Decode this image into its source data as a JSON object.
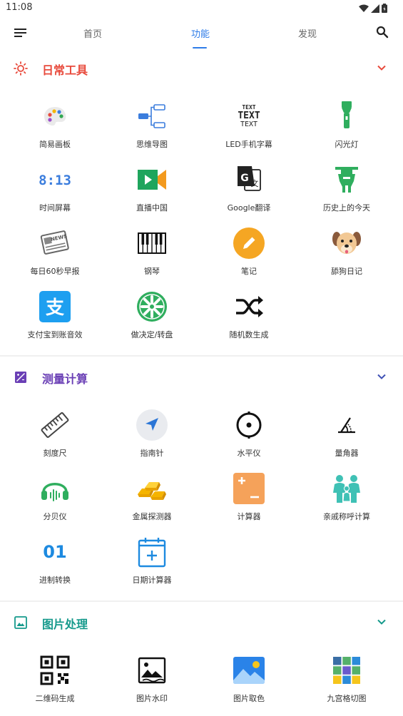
{
  "status": {
    "time": "11:08"
  },
  "tabs": [
    {
      "label": "首页"
    },
    {
      "label": "功能"
    },
    {
      "label": "发现"
    }
  ],
  "sections": [
    {
      "title": "日常工具",
      "color": "#e84a3c",
      "items": [
        {
          "label": "简易画板",
          "icon": "palette-icon"
        },
        {
          "label": "思维导图",
          "icon": "mindmap-icon"
        },
        {
          "label": "LED手机字幕",
          "icon": "led-text-icon"
        },
        {
          "label": "闪光灯",
          "icon": "flashlight-icon"
        },
        {
          "label": "时间屏幕",
          "icon": "clock-digits-icon",
          "icon_text": "8:13"
        },
        {
          "label": "直播中国",
          "icon": "video-camera-icon"
        },
        {
          "label": "Google翻译",
          "icon": "translate-icon"
        },
        {
          "label": "历史上的今天",
          "icon": "history-today-icon"
        },
        {
          "label": "每日60秒早报",
          "icon": "newspaper-icon",
          "icon_text": "NEWS"
        },
        {
          "label": "钢琴",
          "icon": "piano-icon"
        },
        {
          "label": "笔记",
          "icon": "pencil-note-icon"
        },
        {
          "label": "舔狗日记",
          "icon": "dog-face-icon"
        },
        {
          "label": "支付宝到账音效",
          "icon": "alipay-icon",
          "icon_text": "支"
        },
        {
          "label": "做决定/转盘",
          "icon": "wheel-icon"
        },
        {
          "label": "随机数生成",
          "icon": "shuffle-icon"
        }
      ]
    },
    {
      "title": "测量计算",
      "color": "#6a3fb5",
      "items": [
        {
          "label": "刻度尺",
          "icon": "ruler-icon"
        },
        {
          "label": "指南针",
          "icon": "compass-icon"
        },
        {
          "label": "水平仪",
          "icon": "level-icon"
        },
        {
          "label": "量角器",
          "icon": "protractor-icon"
        },
        {
          "label": "分贝仪",
          "icon": "headphones-icon"
        },
        {
          "label": "金属探测器",
          "icon": "gold-bars-icon"
        },
        {
          "label": "计算器",
          "icon": "calculator-icon"
        },
        {
          "label": "亲戚称呼计算",
          "icon": "family-icon"
        },
        {
          "label": "进制转换",
          "icon": "binary-icon",
          "icon_text": "01"
        },
        {
          "label": "日期计算器",
          "icon": "calendar-plus-icon"
        }
      ]
    },
    {
      "title": "图片处理",
      "color": "#169a8c",
      "items": [
        {
          "label": "二维码生成",
          "icon": "qrcode-icon"
        },
        {
          "label": "图片水印",
          "icon": "image-watermark-icon"
        },
        {
          "label": "图片取色",
          "icon": "image-color-icon"
        },
        {
          "label": "九宫格切图",
          "icon": "nine-grid-icon"
        }
      ]
    }
  ]
}
